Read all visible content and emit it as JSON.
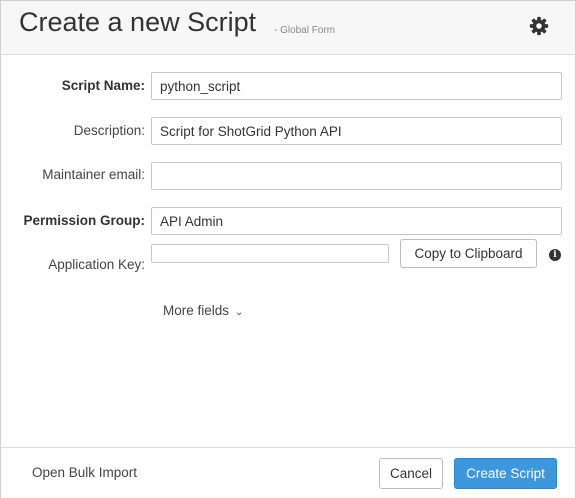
{
  "dialog": {
    "title": "Create a new Script",
    "subtitle": "- Global Form",
    "settings_icon": "gear-icon"
  },
  "form": {
    "script_name": {
      "label": "Script Name:",
      "value": "python_script"
    },
    "description": {
      "label": "Description:",
      "value": "Script for ShotGrid Python API"
    },
    "maintainer_email": {
      "label": "Maintainer email:",
      "value": ""
    },
    "permission_group": {
      "label": "Permission Group:",
      "value": "API Admin"
    },
    "application_key": {
      "label": "Application Key:",
      "value": "",
      "copy_label": "Copy to Clipboard",
      "info_icon": "info-icon"
    },
    "more_fields": "More fields"
  },
  "footer": {
    "bulk_import": "Open Bulk Import",
    "cancel": "Cancel",
    "create": "Create Script"
  },
  "colors": {
    "primary_button": "#3d97dc",
    "header_bg": "#f7f7f7"
  }
}
